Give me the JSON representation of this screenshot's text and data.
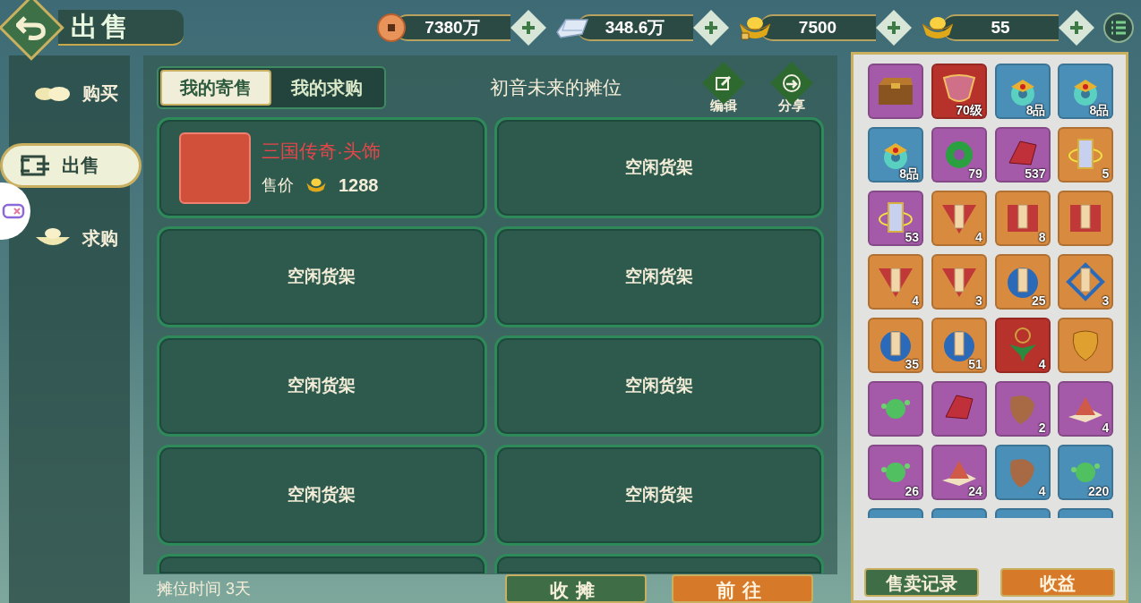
{
  "header": {
    "title": "出售"
  },
  "currencies": [
    {
      "kind": "copper",
      "value": "7380万"
    },
    {
      "kind": "silver",
      "value": "348.6万"
    },
    {
      "kind": "bound",
      "value": "7500"
    },
    {
      "kind": "gold",
      "value": "55"
    }
  ],
  "sidebar": {
    "items": [
      {
        "label": "购买",
        "selected": false
      },
      {
        "label": "出售",
        "selected": true
      },
      {
        "label": "求购",
        "selected": false
      }
    ]
  },
  "tabs": [
    {
      "label": "我的寄售",
      "selected": true
    },
    {
      "label": "我的求购",
      "selected": false
    }
  ],
  "stall_title": "初音未来的摊位",
  "actions": [
    {
      "kind": "edit",
      "label": "编辑"
    },
    {
      "kind": "share",
      "label": "分享"
    }
  ],
  "slots": [
    {
      "kind": "item",
      "name": "三国传奇·头饰",
      "price_label": "售价",
      "price": "1288"
    },
    {
      "kind": "idle",
      "label": "空闲货架"
    },
    {
      "kind": "idle",
      "label": "空闲货架"
    },
    {
      "kind": "idle",
      "label": "空闲货架"
    },
    {
      "kind": "idle",
      "label": "空闲货架"
    },
    {
      "kind": "idle",
      "label": "空闲货架"
    },
    {
      "kind": "idle",
      "label": "空闲货架"
    },
    {
      "kind": "idle",
      "label": "空闲货架"
    },
    {
      "kind": "cut"
    },
    {
      "kind": "cut"
    }
  ],
  "footer": {
    "stall_time": "摊位时间 3天",
    "buttons": [
      {
        "kind": "green",
        "label": "收摊"
      },
      {
        "kind": "orange",
        "label": "前往"
      }
    ]
  },
  "inventory": {
    "items": [
      {
        "kind": "chest",
        "color": "#a45aa8"
      },
      {
        "kind": "helmet",
        "color": "#b8322c",
        "count": "70级"
      },
      {
        "kind": "pendant",
        "color": "#4a8fb8",
        "count": "8品"
      },
      {
        "kind": "pendant",
        "color": "#4a8fb8",
        "count": "8品"
      },
      {
        "kind": "pendant",
        "color": "#4a8fb8",
        "count": "8品"
      },
      {
        "kind": "ring",
        "color": "#a45aa8",
        "count": "79"
      },
      {
        "kind": "crystal",
        "color": "#a45aa8",
        "count": "537"
      },
      {
        "kind": "scroll",
        "color": "#d88a3e",
        "count": "5"
      },
      {
        "kind": "scroll",
        "color": "#a45aa8",
        "count": "53"
      },
      {
        "kind": "triangle",
        "color": "#d88a3e",
        "count": "4"
      },
      {
        "kind": "frame",
        "color": "#d88a3e",
        "count": "8"
      },
      {
        "kind": "frame",
        "color": "#d88a3e"
      },
      {
        "kind": "triangle",
        "color": "#d88a3e",
        "count": "4"
      },
      {
        "kind": "triangle",
        "color": "#d88a3e",
        "count": "3"
      },
      {
        "kind": "disc",
        "color": "#d88a3e",
        "count": "25"
      },
      {
        "kind": "diamond",
        "color": "#d88a3e",
        "count": "3"
      },
      {
        "kind": "disc",
        "color": "#d88a3e",
        "count": "35"
      },
      {
        "kind": "disc",
        "color": "#d88a3e",
        "count": "51"
      },
      {
        "kind": "necklace",
        "color": "#b8322c",
        "count": "4"
      },
      {
        "kind": "charm",
        "color": "#d88a3e"
      },
      {
        "kind": "gem",
        "color": "#a45aa8"
      },
      {
        "kind": "crystal",
        "color": "#a45aa8"
      },
      {
        "kind": "fur",
        "color": "#a45aa8",
        "count": "2"
      },
      {
        "kind": "powder",
        "color": "#a45aa8",
        "count": "4"
      },
      {
        "kind": "gem",
        "color": "#a45aa8",
        "count": "26"
      },
      {
        "kind": "powder",
        "color": "#a45aa8",
        "count": "24"
      },
      {
        "kind": "fur",
        "color": "#4a8fb8",
        "count": "4"
      },
      {
        "kind": "gem",
        "color": "#4a8fb8",
        "count": "220"
      },
      {
        "kind": "cut",
        "color": "#4a8fb8"
      },
      {
        "kind": "cut",
        "color": "#4a8fb8"
      },
      {
        "kind": "cut",
        "color": "#4a8fb8"
      },
      {
        "kind": "cut",
        "color": "#4a8fb8"
      }
    ],
    "buttons": [
      {
        "kind": "green",
        "label": "售卖记录"
      },
      {
        "kind": "orange",
        "label": "收益"
      }
    ]
  }
}
